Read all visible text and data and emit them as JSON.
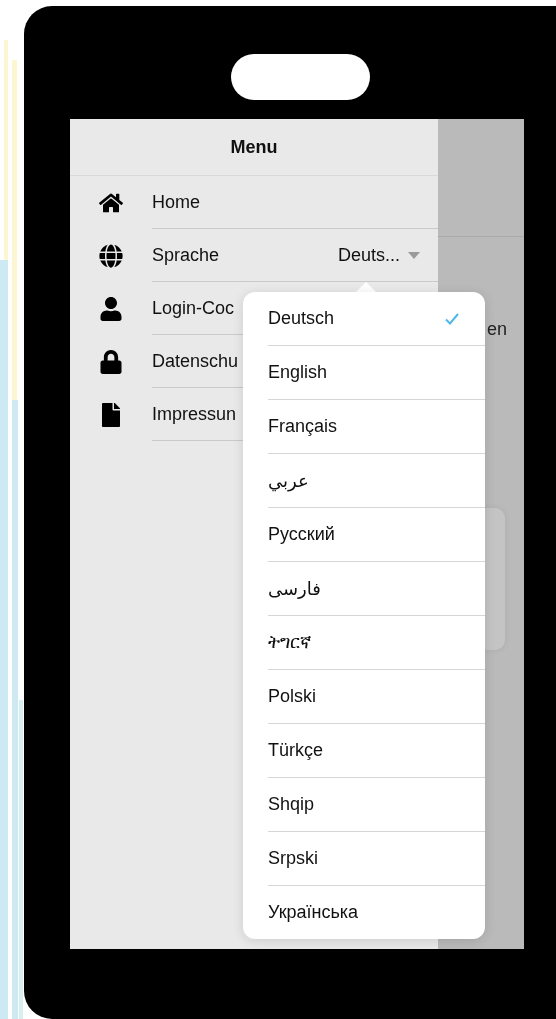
{
  "menu": {
    "title": "Menu",
    "items": [
      {
        "kind": "link",
        "label": "Home"
      },
      {
        "kind": "select",
        "label": "Sprache",
        "value": "Deuts..."
      },
      {
        "kind": "link",
        "label": "Login-Coc"
      },
      {
        "kind": "link",
        "label": "Datenschu"
      },
      {
        "kind": "link",
        "label": "Impressun"
      }
    ]
  },
  "background_fragments": [
    "en"
  ],
  "language_popover": {
    "options": [
      {
        "label": "Deutsch",
        "selected": true
      },
      {
        "label": "English",
        "selected": false
      },
      {
        "label": "Français",
        "selected": false
      },
      {
        "label": "عربي",
        "selected": false
      },
      {
        "label": "Русский",
        "selected": false
      },
      {
        "label": "فارسی",
        "selected": false
      },
      {
        "label": "ትግርኛ",
        "selected": false
      },
      {
        "label": "Polski",
        "selected": false
      },
      {
        "label": "Türkçe",
        "selected": false
      },
      {
        "label": "Shqip",
        "selected": false
      },
      {
        "label": "Srpski",
        "selected": false
      },
      {
        "label": "Українська",
        "selected": false
      }
    ]
  }
}
